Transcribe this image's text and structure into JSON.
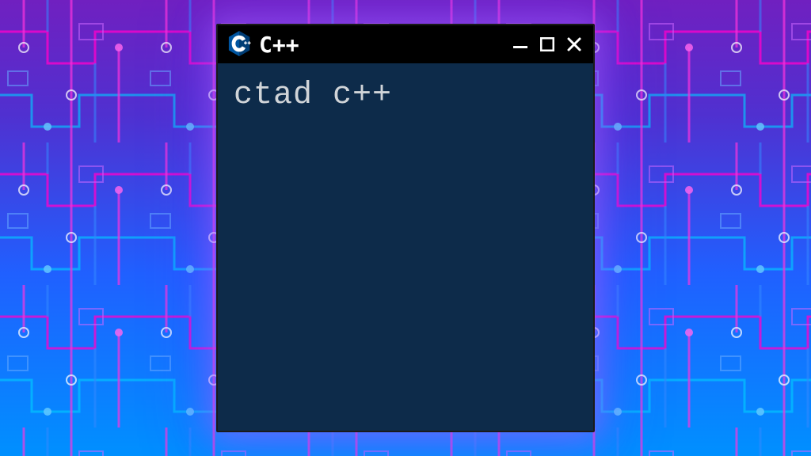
{
  "window": {
    "title": "C++",
    "icon_label": "C++"
  },
  "content": {
    "text": "ctad c++"
  },
  "colors": {
    "content_bg": "#0d2b4a",
    "titlebar_bg": "#000000",
    "text": "#d0d4d8"
  }
}
